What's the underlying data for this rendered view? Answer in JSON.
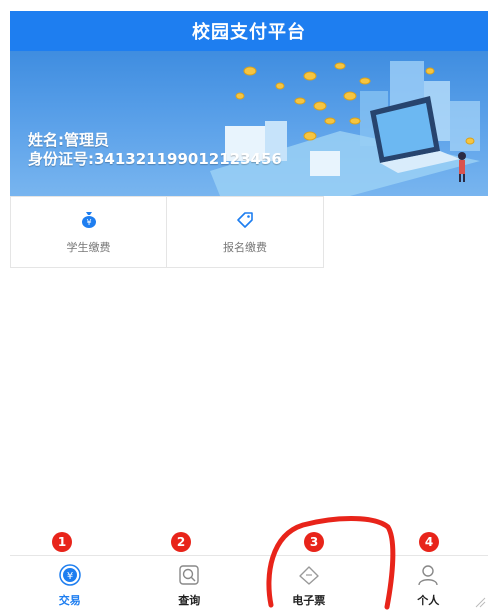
{
  "header": {
    "title": "校园支付平台"
  },
  "user": {
    "name": "姓名:管理员",
    "id_number": "身份证号:341321199012123456"
  },
  "services": [
    {
      "label": "学生缴费",
      "icon": "money-bag-icon"
    },
    {
      "label": "报名缴费",
      "icon": "tag-icon"
    }
  ],
  "tabs": [
    {
      "label": "交易",
      "icon": "yuan-coin-icon",
      "active": true
    },
    {
      "label": "查询",
      "icon": "search-icon",
      "active": false
    },
    {
      "label": "电子票",
      "icon": "ticket-icon",
      "active": false
    },
    {
      "label": "个人",
      "icon": "person-icon",
      "active": false
    }
  ],
  "badges": [
    "1",
    "2",
    "3",
    "4"
  ],
  "colors": {
    "primary": "#1e7ef0",
    "badge": "#e8241a",
    "annotation": "#e8241a"
  }
}
